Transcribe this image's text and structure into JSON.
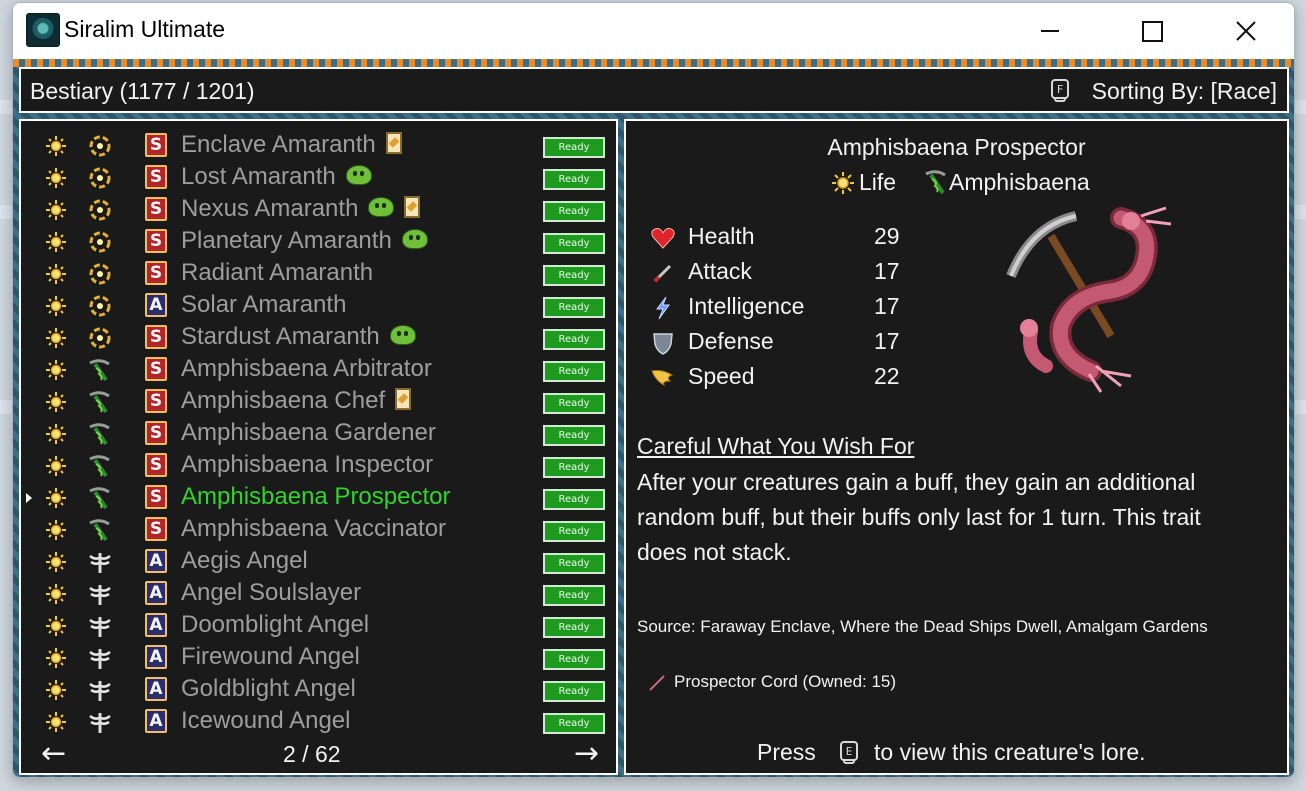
{
  "window": {
    "title": "Siralim Ultimate",
    "controls": [
      "minimize",
      "maximize",
      "close"
    ]
  },
  "header": {
    "title": "Bestiary (1177 / 1201)",
    "sort_key": "F",
    "sort_label": "Sorting By: [Race]"
  },
  "list": {
    "rows": [
      {
        "name": "Enclave Amaranth",
        "class": "S",
        "race_icon": "amaranth-icon",
        "badges": [
          "card"
        ],
        "status": "Ready"
      },
      {
        "name": "Lost Amaranth",
        "class": "S",
        "race_icon": "amaranth-icon",
        "badges": [
          "slime"
        ],
        "status": "Ready"
      },
      {
        "name": "Nexus Amaranth",
        "class": "S",
        "race_icon": "amaranth-icon",
        "badges": [
          "slime",
          "card"
        ],
        "status": "Ready"
      },
      {
        "name": "Planetary Amaranth",
        "class": "S",
        "race_icon": "amaranth-icon",
        "badges": [
          "slime"
        ],
        "status": "Ready"
      },
      {
        "name": "Radiant Amaranth",
        "class": "S",
        "race_icon": "amaranth-icon",
        "badges": [],
        "status": "Ready"
      },
      {
        "name": "Solar Amaranth",
        "class": "A",
        "race_icon": "amaranth-icon",
        "badges": [],
        "status": "Ready"
      },
      {
        "name": "Stardust Amaranth",
        "class": "S",
        "race_icon": "amaranth-icon",
        "badges": [
          "slime"
        ],
        "status": "Ready"
      },
      {
        "name": "Amphisbaena Arbitrator",
        "class": "S",
        "race_icon": "amphisbaena-icon",
        "badges": [],
        "status": "Ready"
      },
      {
        "name": "Amphisbaena Chef",
        "class": "S",
        "race_icon": "amphisbaena-icon",
        "badges": [
          "card"
        ],
        "status": "Ready"
      },
      {
        "name": "Amphisbaena Gardener",
        "class": "S",
        "race_icon": "amphisbaena-icon",
        "badges": [],
        "status": "Ready"
      },
      {
        "name": "Amphisbaena Inspector",
        "class": "S",
        "race_icon": "amphisbaena-icon",
        "badges": [],
        "status": "Ready"
      },
      {
        "name": "Amphisbaena Prospector",
        "class": "S",
        "race_icon": "amphisbaena-icon",
        "badges": [],
        "status": "Ready",
        "selected": true
      },
      {
        "name": "Amphisbaena Vaccinator",
        "class": "S",
        "race_icon": "amphisbaena-icon",
        "badges": [],
        "status": "Ready"
      },
      {
        "name": "Aegis Angel",
        "class": "A",
        "race_icon": "angel-icon",
        "badges": [],
        "status": "Ready"
      },
      {
        "name": "Angel Soulslayer",
        "class": "A",
        "race_icon": "angel-icon",
        "badges": [],
        "status": "Ready"
      },
      {
        "name": "Doomblight Angel",
        "class": "A",
        "race_icon": "angel-icon",
        "badges": [],
        "status": "Ready"
      },
      {
        "name": "Firewound Angel",
        "class": "A",
        "race_icon": "angel-icon",
        "badges": [],
        "status": "Ready"
      },
      {
        "name": "Goldblight Angel",
        "class": "A",
        "race_icon": "angel-icon",
        "badges": [],
        "status": "Ready"
      },
      {
        "name": "Icewound Angel",
        "class": "A",
        "race_icon": "angel-icon",
        "badges": [],
        "status": "Ready"
      }
    ],
    "page": "2 / 62",
    "prev_icon": "arrow-left-icon",
    "next_icon": "arrow-right-icon"
  },
  "detail": {
    "name": "Amphisbaena Prospector",
    "class_label": "Life",
    "race_label": "Amphisbaena",
    "stats": [
      {
        "label": "Health",
        "value": "29",
        "icon": "heart-icon"
      },
      {
        "label": "Attack",
        "value": "17",
        "icon": "sword-icon"
      },
      {
        "label": "Intelligence",
        "value": "17",
        "icon": "lightning-icon"
      },
      {
        "label": "Defense",
        "value": "17",
        "icon": "shield-icon"
      },
      {
        "label": "Speed",
        "value": "22",
        "icon": "wing-icon"
      }
    ],
    "trait_title": "Careful What You Wish For",
    "trait_desc": "After your creatures gain a buff, they gain an additional random buff, but their buffs only last for 1 turn. This trait does not stack.",
    "source": "Source: Faraway Enclave, Where the Dead Ships Dwell, Amalgam Gardens",
    "material": "Prospector Cord (Owned: 15)",
    "press_label": "Press",
    "press_key": "E",
    "lore_label": "to view this creature's lore."
  },
  "colors": {
    "panel_bg": "#1a1a1a",
    "text": "#f2f2f2",
    "list_text": "#9d9d9d",
    "selected": "#2fd42f",
    "ready_bg": "#1e9a1e"
  }
}
